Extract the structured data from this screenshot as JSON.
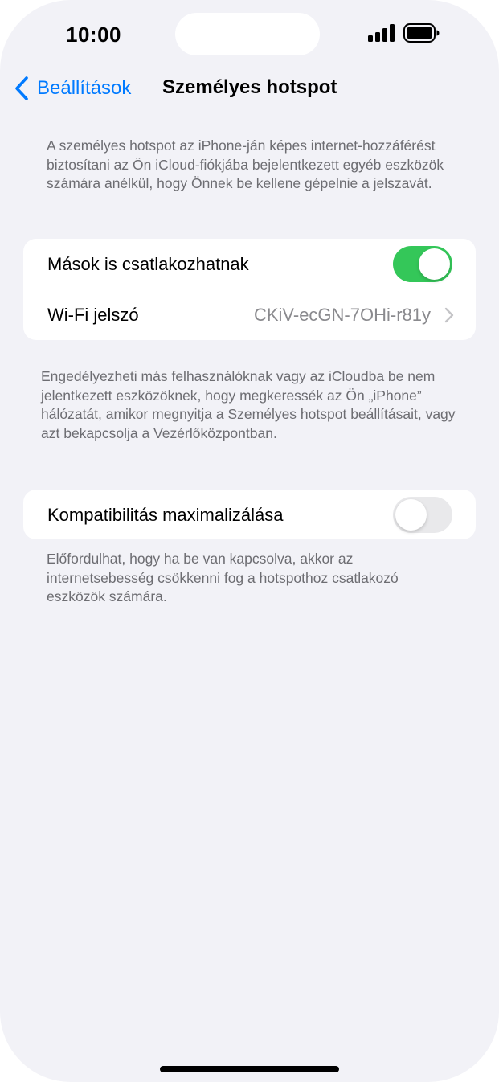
{
  "status_bar": {
    "time": "10:00",
    "signal_icon": "cellular-signal-icon",
    "battery_icon": "battery-full-icon"
  },
  "nav": {
    "back_label": "Beállítások",
    "back_icon": "chevron-left-icon",
    "title": "Személyes hotspot"
  },
  "intro_text": "A személyes hotspot az iPhone-ján képes internet-hozzáférést biztosítani az Ön iCloud-fiókjába bejelentkezett egyéb eszközök számára anélkül, hogy Önnek be kellene gépelnie a jelszavát.",
  "group1": {
    "allow_others": {
      "label": "Mások is csatlakozhatnak",
      "enabled": true
    },
    "wifi_password": {
      "label": "Wi-Fi jelszó",
      "value": "CKiV-ecGN-7OHi-r81y"
    }
  },
  "group1_footer": "Engedélyezheti más felhasználóknak vagy az iCloudba be nem jelentkezett eszközöknek, hogy megkeressék az Ön „iPhone” hálózatát, amikor megnyitja a Személyes hotspot beállításait, vagy azt bekapcsolja a Vezérlőközpontban.",
  "group2": {
    "maximize_compat": {
      "label": "Kompatibilitás maximalizálása",
      "enabled": false
    }
  },
  "group2_footer": "Előfordulhat, hogy ha be van kapcsolva, akkor az internetsebesség csökkenni fog a hotspothoz csatlakozó eszközök számára.",
  "colors": {
    "accent": "#007aff",
    "toggle_on": "#34c759",
    "toggle_off": "#e9e9eb",
    "background": "#f2f2f7"
  }
}
